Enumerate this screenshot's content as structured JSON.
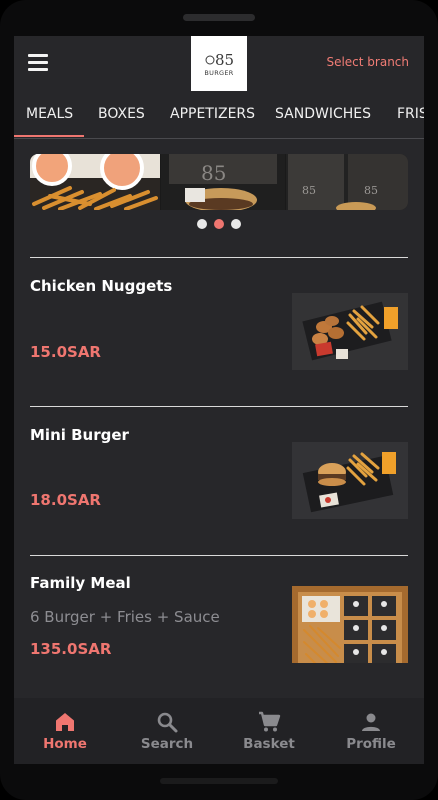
{
  "header": {
    "logo_number": "85",
    "logo_word": "BURGER",
    "select_branch": "Select branch"
  },
  "tabs": [
    {
      "label": "MEALS",
      "active": true
    },
    {
      "label": "BOXES"
    },
    {
      "label": "APPETIZERS"
    },
    {
      "label": "SANDWICHES"
    },
    {
      "label": "FRIS"
    }
  ],
  "banner": {
    "slides": 3,
    "active_slide": 2
  },
  "items": [
    {
      "name": "Chicken Nuggets",
      "description": "",
      "price": "15.0SAR"
    },
    {
      "name": "Mini Burger",
      "description": "",
      "price": "18.0SAR"
    },
    {
      "name": "Family Meal",
      "description": "6 Burger + Fries + Sauce",
      "price": "135.0SAR"
    }
  ],
  "bottom_nav": [
    {
      "label": "Home",
      "icon": "home-icon",
      "active": true
    },
    {
      "label": "Search",
      "icon": "search-icon"
    },
    {
      "label": "Basket",
      "icon": "basket-icon"
    },
    {
      "label": "Profile",
      "icon": "profile-icon"
    }
  ],
  "colors": {
    "accent": "#ef7670",
    "background": "#27272a",
    "nav_background": "#222225",
    "text": "#ffffff",
    "muted": "#8d8d92"
  }
}
